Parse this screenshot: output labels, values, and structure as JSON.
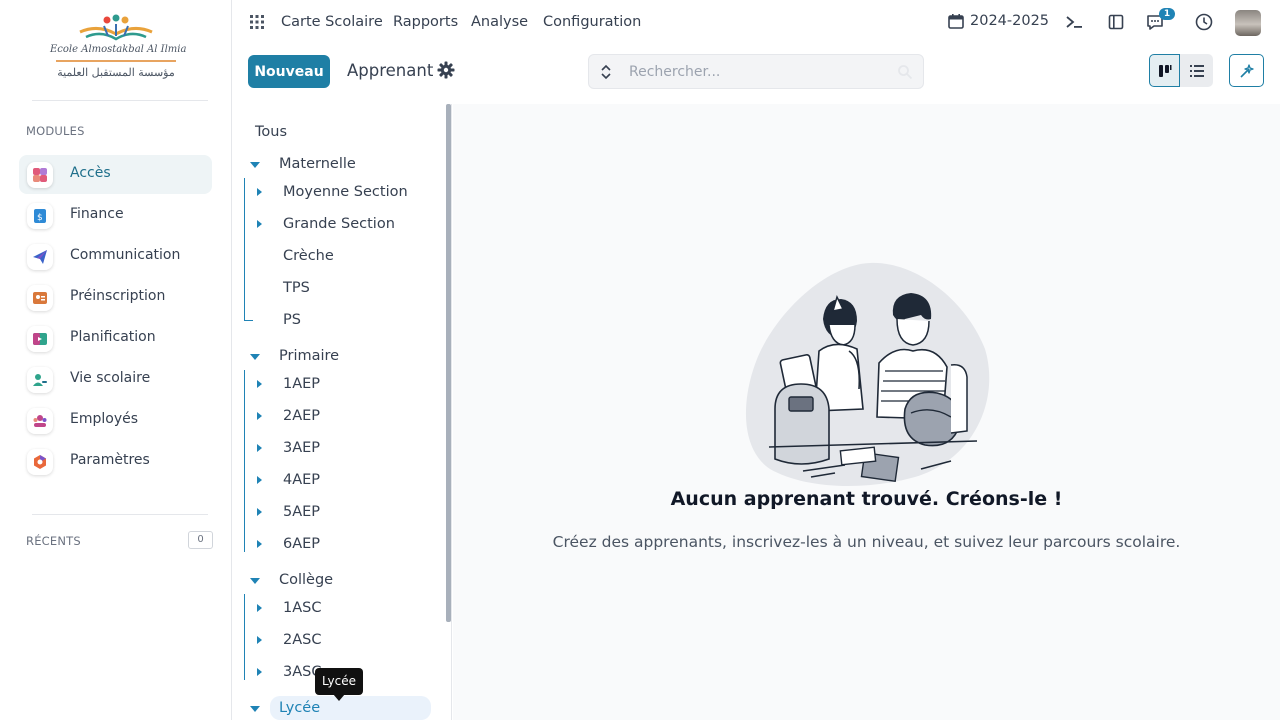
{
  "logo": {
    "school_name": "Ecole Almostakbal Al Ilmia",
    "arabic_name": "مؤسسة المستقبل العلمية"
  },
  "sidebar": {
    "modules_label": "MODULES",
    "modules": [
      {
        "label": "Accès",
        "icon": "access-icon",
        "active": true
      },
      {
        "label": "Finance",
        "icon": "finance-icon"
      },
      {
        "label": "Communication",
        "icon": "communication-icon"
      },
      {
        "label": "Préinscription",
        "icon": "preinscription-icon"
      },
      {
        "label": "Planification",
        "icon": "planning-icon"
      },
      {
        "label": "Vie scolaire",
        "icon": "school-life-icon"
      },
      {
        "label": "Employés",
        "icon": "employees-icon"
      },
      {
        "label": "Paramètres",
        "icon": "settings-icon"
      }
    ],
    "recents_label": "RÉCENTS",
    "recents_count": "0"
  },
  "topbar": {
    "nav": [
      "Carte Scolaire",
      "Rapports",
      "Analyse",
      "Configuration"
    ],
    "year": "2024-2025",
    "notification_count": "1"
  },
  "control": {
    "new_button": "Nouveau",
    "breadcrumb": "Apprenant",
    "search_placeholder": "Rechercher..."
  },
  "tree": {
    "all": "Tous",
    "maternelle": {
      "label": "Maternelle",
      "children": [
        "Moyenne Section",
        "Grande Section",
        "Crèche",
        "TPS",
        "PS"
      ]
    },
    "primaire": {
      "label": "Primaire",
      "children": [
        "1AEP",
        "2AEP",
        "3AEP",
        "4AEP",
        "5AEP",
        "6AEP"
      ]
    },
    "college": {
      "label": "Collège",
      "children": [
        "1ASC",
        "2ASC",
        "3ASC"
      ]
    },
    "lycee": {
      "label": "Lycée"
    },
    "tooltip": "Lycée"
  },
  "empty_state": {
    "title": "Aucun apprenant trouvé. Créons-le !",
    "subtitle": "Créez des apprenants, inscrivez-les à un niveau, et suivez leur parcours scolaire."
  },
  "colors": {
    "primary": "#1f7fa5",
    "tree_accent": "#1f83b5",
    "active_module_bg": "#eef4f6"
  }
}
